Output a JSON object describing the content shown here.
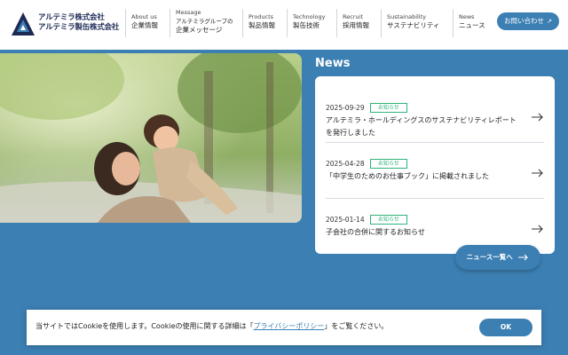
{
  "header": {
    "logo": {
      "line1": "アルテミラ株式会社",
      "line2": "アルテミラ製缶株式会社"
    },
    "nav": [
      {
        "en": "About us",
        "jp": "企業情報"
      },
      {
        "en": "Message",
        "jp": "アルテミラグループの",
        "jp2": "企業メッセージ"
      },
      {
        "en": "Products",
        "jp": "製品情報"
      },
      {
        "en": "Technology",
        "jp": "製缶技術"
      },
      {
        "en": "Recruit",
        "jp": "採用情報"
      },
      {
        "en": "Sustainability",
        "jp": "サステナビリティ"
      },
      {
        "en": "News",
        "jp": "ニュース"
      }
    ],
    "contact_label": "お問い合わせ"
  },
  "news": {
    "title": "News",
    "items": [
      {
        "date": "2025-09-29",
        "badge": "お知らせ",
        "text": "アルテミラ・ホールディングスのサステナビリティレポートを発行しました"
      },
      {
        "date": "2025-04-28",
        "badge": "お知らせ",
        "text": "「中学生のためのお仕事ブック」に掲載されました"
      },
      {
        "date": "2025-01-14",
        "badge": "お知らせ",
        "text": "子会社の合併に関するお知らせ"
      }
    ],
    "all_button": "ニュース一覧へ"
  },
  "cookie": {
    "text_before": "当サイトではCookieを使用します。Cookieの使用に関する詳細は「",
    "link": "プライバシーポリシー",
    "text_after": "」をご覧ください。",
    "ok": "OK"
  },
  "colors": {
    "brand_blue": "#3b7fb3",
    "navy": "#1e2a55",
    "badge_green": "#2fb37a"
  },
  "icons": [
    "logo-mark-icon",
    "external-link-icon",
    "arrow-right-icon"
  ]
}
